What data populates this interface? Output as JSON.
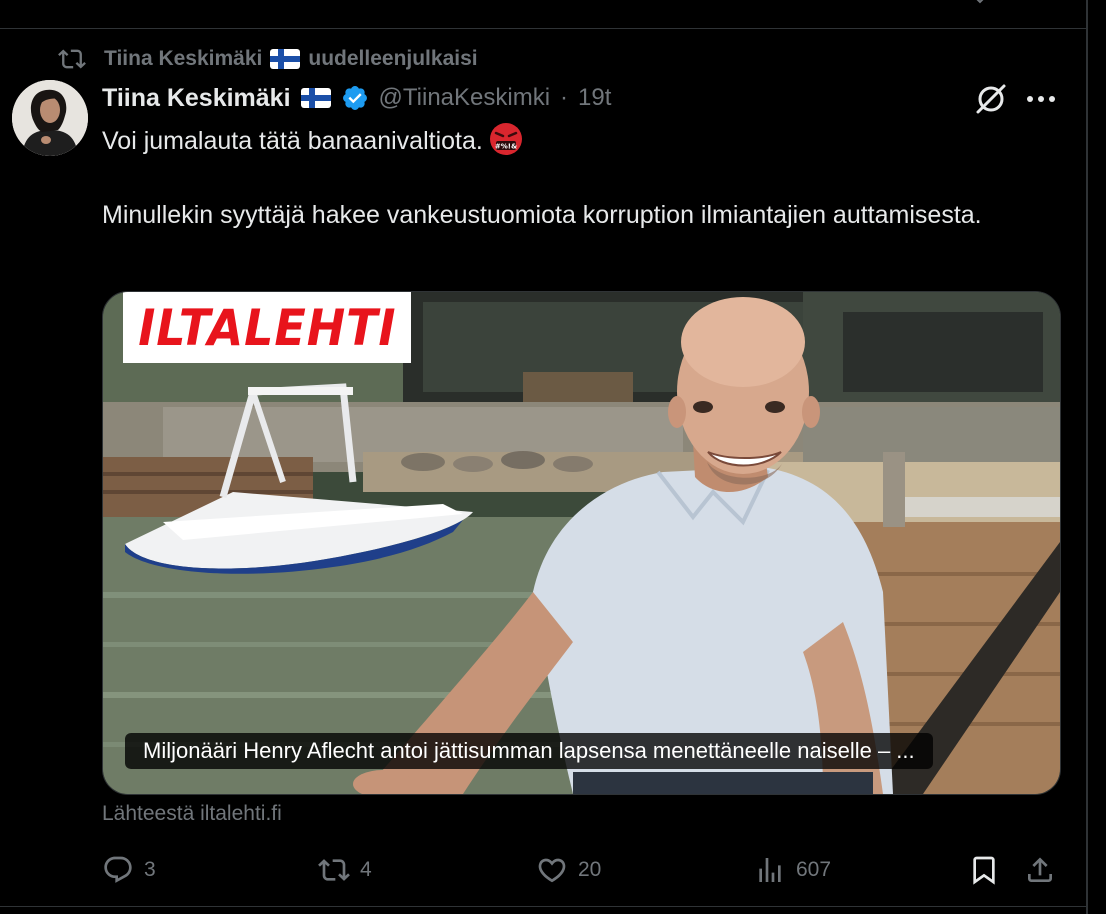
{
  "repost": {
    "user": "Tiina Keskimäki",
    "action": "uudelleenjulkaisi"
  },
  "author": {
    "name": "Tiina Keskimäki",
    "handle": "@TiinaKeskimki",
    "separator": "·",
    "time": "19t"
  },
  "tweet": {
    "line1": "Voi jumalauta tätä banaanivaltiota.",
    "line2": "Minullekin syyttäjä hakee vankeustuomiota korruption ilmiantajien auttamisesta."
  },
  "card": {
    "brand": "ILTALEHTI",
    "caption": "Miljonääri Henry Aflecht antoi jättisumman lapsensa menettäneelle naiselle – ...",
    "source": "Lähteestä iltalehti.fi"
  },
  "actions": {
    "replies": "3",
    "reposts": "4",
    "likes": "20",
    "views": "607"
  },
  "icons": {
    "repost": "repost-icon",
    "verified": "verified-badge-icon",
    "grok": "grok-icon",
    "more": "more-icon",
    "reply": "reply-icon",
    "retweet": "retweet-icon",
    "like": "heart-icon",
    "views": "views-icon",
    "bookmark": "bookmark-icon",
    "share": "share-icon",
    "emoji": "face-with-symbols-emoji"
  },
  "colors": {
    "background": "#000000",
    "text": "#e7e9ea",
    "muted": "#71767b",
    "verified": "#1d9bf0",
    "brand": "#e8141c"
  }
}
